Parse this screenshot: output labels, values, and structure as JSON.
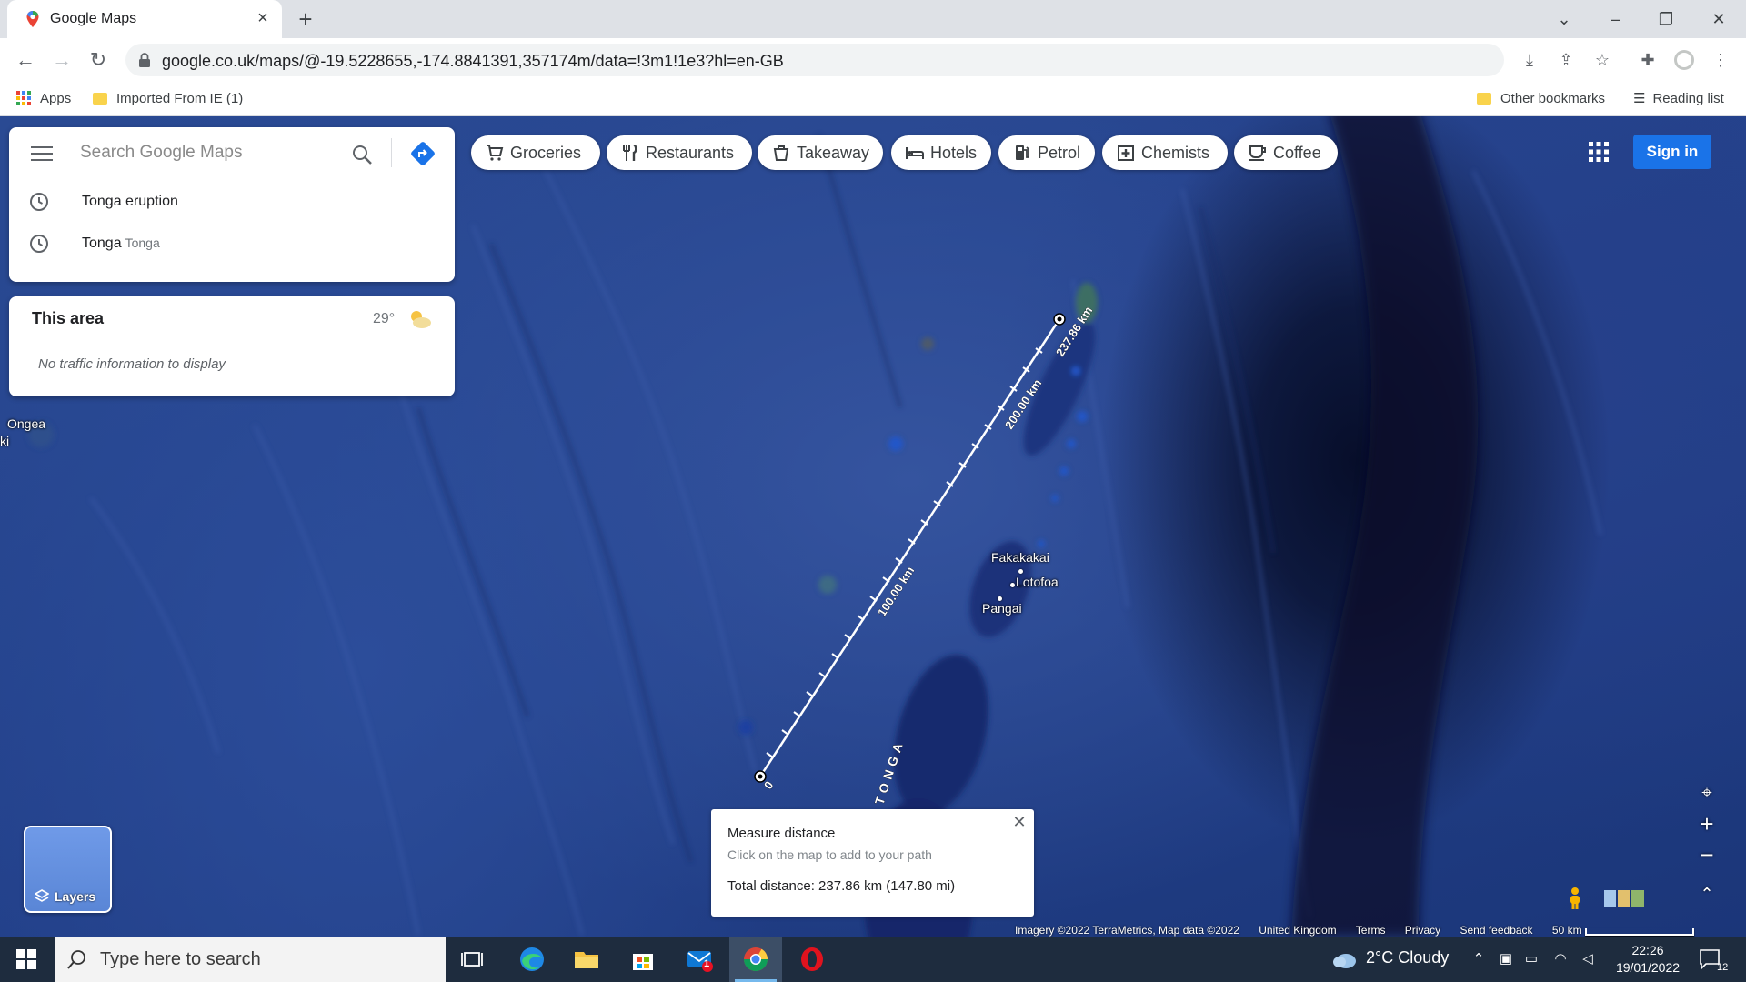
{
  "browser": {
    "tab_title": "Google Maps",
    "url": "google.co.uk/maps/@-19.5228655,-174.8841391,357174m/data=!3m1!1e3?hl=en-GB",
    "bookmarks": {
      "apps": "Apps",
      "imported": "Imported From IE (1)",
      "other": "Other bookmarks",
      "reading_list": "Reading list"
    }
  },
  "search": {
    "placeholder": "Search Google Maps",
    "recent": [
      {
        "label": "Tonga eruption",
        "sub": ""
      },
      {
        "label": "Tonga",
        "sub": "Tonga"
      }
    ]
  },
  "area_card": {
    "title": "This area",
    "temperature": "29°",
    "traffic": "No traffic information to display"
  },
  "categories": [
    "Groceries",
    "Restaurants",
    "Takeaway",
    "Hotels",
    "Petrol",
    "Chemists",
    "Coffee"
  ],
  "sign_in": "Sign in",
  "places": [
    "Ongea",
    "ki",
    "Fakakakai",
    "Lotofoa",
    "Pangai",
    "TONGA"
  ],
  "measure": {
    "title": "Measure distance",
    "hint": "Click on the map to add to your path",
    "total": "Total distance: 237.86 km (147.80 mi)",
    "labels": [
      "237.86 km",
      "200.00 km",
      "100.00 km",
      "0"
    ]
  },
  "layers_label": "Layers",
  "footer": {
    "imagery": "Imagery ©2022 TerraMetrics, Map data ©2022",
    "country": "United Kingdom",
    "terms": "Terms",
    "privacy": "Privacy",
    "feedback": "Send feedback",
    "scale": "50 km"
  },
  "taskbar": {
    "search_placeholder": "Type here to search",
    "weather": "2°C  Cloudy",
    "time": "22:26",
    "date": "19/01/2022",
    "notifications": "12",
    "mail_badge": "1"
  },
  "colors": {
    "accent": "#1a73e8",
    "map_blue": "#23418b"
  }
}
